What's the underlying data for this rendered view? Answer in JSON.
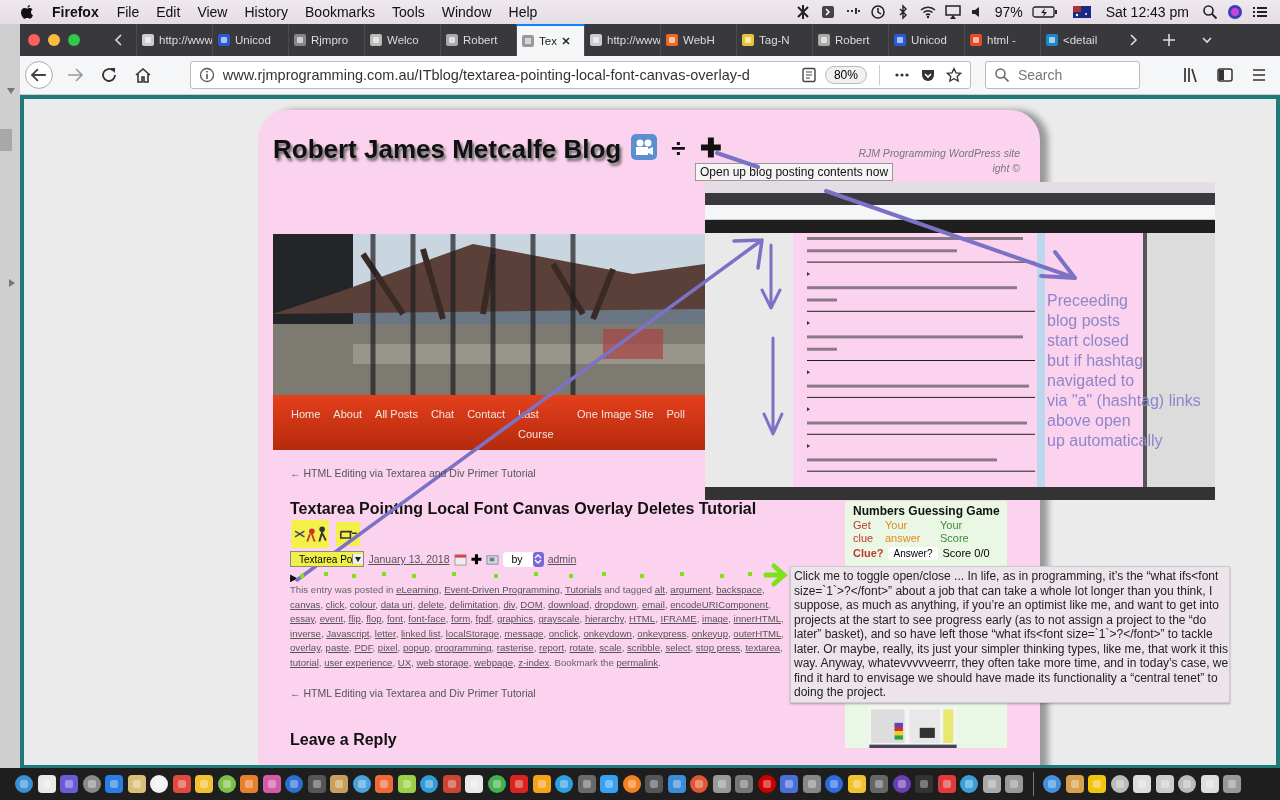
{
  "menubar": {
    "app": "Firefox",
    "menus": [
      "File",
      "Edit",
      "View",
      "History",
      "Bookmarks",
      "Tools",
      "Window",
      "Help"
    ],
    "battery": "97%",
    "clock": "Sat 12:43 pm"
  },
  "tabs": [
    {
      "label": "http://www",
      "selected": false
    },
    {
      "label": "Unicod",
      "selected": false
    },
    {
      "label": "Rjmpro",
      "selected": false
    },
    {
      "label": "Welco",
      "selected": false
    },
    {
      "label": "Robert",
      "selected": false
    },
    {
      "label": "Tex",
      "selected": true
    },
    {
      "label": "http://www",
      "selected": false
    },
    {
      "label": "WebH",
      "selected": false
    },
    {
      "label": "Tag-N",
      "selected": false
    },
    {
      "label": "Robert",
      "selected": false
    },
    {
      "label": "Unicod",
      "selected": false
    },
    {
      "label": "html -",
      "selected": false
    },
    {
      "label": "<detail",
      "selected": false
    }
  ],
  "address_bar": {
    "url": "www.rjmprogramming.com.au/ITblog/textarea-pointing-local-font-canvas-overlay-d",
    "zoom": "80%"
  },
  "search": {
    "placeholder": "Search"
  },
  "blog": {
    "title": "Robert James Metcalfe Blog",
    "title_symbols": [
      "÷",
      "✚"
    ],
    "tooltip": "Open up blog posting contents now",
    "site_note": [
      "RJM Programming WordPress site",
      "ight ©"
    ],
    "nav": [
      {
        "label": "Home"
      },
      {
        "label": "About"
      },
      {
        "label": "All Posts"
      },
      {
        "label": "Chat"
      },
      {
        "label": "Contact"
      },
      {
        "label": "Last Course"
      },
      {
        "label": "One Image Site"
      },
      {
        "label": "Poll"
      }
    ],
    "prev_link": "← HTML Editing via Textarea and Div Primer Tutorial",
    "post": {
      "title": "Textarea Pointing Local Font Canvas Overlay Deletes Tutorial",
      "select_value": "Textarea Po",
      "date": "January 13, 2018",
      "plus": "✚",
      "by": "by",
      "author": "admin",
      "toggle": "▶",
      "meta": {
        "intro": "This entry was posted in ",
        "links": [
          {
            "text": "eLearning",
            "after": ", "
          },
          {
            "text": "Event-Driven Programming",
            "after": ", "
          },
          {
            "text": "Tutorials",
            "after": " and tagged "
          },
          {
            "text": "alt",
            "after": ", "
          },
          {
            "text": "argument",
            "after": ", "
          },
          {
            "text": "backspace",
            "after": ", "
          },
          {
            "text": "canvas",
            "after": ", "
          },
          {
            "text": "click",
            "after": ", "
          },
          {
            "text": "colour",
            "after": ", "
          },
          {
            "text": "data uri",
            "after": ", "
          },
          {
            "text": "delete",
            "after": ", "
          },
          {
            "text": "delimitation",
            "after": ", "
          },
          {
            "text": "div",
            "after": ", "
          },
          {
            "text": "DOM",
            "after": ", "
          },
          {
            "text": "download",
            "after": ", "
          },
          {
            "text": "dropdown",
            "after": ", "
          },
          {
            "text": "email",
            "after": ", "
          },
          {
            "text": "encodeURIComponent",
            "after": ", "
          },
          {
            "text": "essay",
            "after": ", "
          },
          {
            "text": "event",
            "after": ", "
          },
          {
            "text": "flip",
            "after": ", "
          },
          {
            "text": "flop",
            "after": ", "
          },
          {
            "text": "font",
            "after": ", "
          },
          {
            "text": "font-face",
            "after": ", "
          },
          {
            "text": "form",
            "after": ", "
          },
          {
            "text": "fpdf",
            "after": ", "
          },
          {
            "text": "graphics",
            "after": ", "
          },
          {
            "text": "grayscale",
            "after": ", "
          },
          {
            "text": "hierarchy",
            "after": ", "
          },
          {
            "text": "HTML",
            "after": ", "
          },
          {
            "text": "IFRAME",
            "after": ", "
          },
          {
            "text": "image",
            "after": ", "
          },
          {
            "text": "innerHTML",
            "after": ", "
          },
          {
            "text": "inverse",
            "after": ", "
          },
          {
            "text": "Javascript",
            "after": ", "
          },
          {
            "text": "letter",
            "after": ", "
          },
          {
            "text": "linked list",
            "after": ", "
          },
          {
            "text": "localStorage",
            "after": ", "
          },
          {
            "text": "message",
            "after": ", "
          },
          {
            "text": "onclick",
            "after": ", "
          },
          {
            "text": "onkeydown",
            "after": ", "
          },
          {
            "text": "onkeypress",
            "after": ", "
          },
          {
            "text": "onkeyup",
            "after": ", "
          },
          {
            "text": "outerHTML",
            "after": ", "
          },
          {
            "text": "overlay",
            "after": ", "
          },
          {
            "text": "paste",
            "after": ", "
          },
          {
            "text": "PDF",
            "after": ", "
          },
          {
            "text": "pixel",
            "after": ", "
          },
          {
            "text": "popup",
            "after": ", "
          },
          {
            "text": "programming",
            "after": ", "
          },
          {
            "text": "rasterise",
            "after": ", "
          },
          {
            "text": "report",
            "after": ", "
          },
          {
            "text": "rotate",
            "after": ", "
          },
          {
            "text": "scale",
            "after": ", "
          },
          {
            "text": "scribble",
            "after": ", "
          },
          {
            "text": "select",
            "after": ", "
          },
          {
            "text": "stop press",
            "after": ", "
          },
          {
            "text": "textarea",
            "after": ", "
          },
          {
            "text": "tutorial",
            "after": ", "
          },
          {
            "text": "user experience",
            "after": ", "
          },
          {
            "text": "UX",
            "after": ", "
          },
          {
            "text": "web storage",
            "after": ", "
          },
          {
            "text": "webpage",
            "after": ", "
          },
          {
            "text": "z-index",
            "after": ". Bookmark the "
          },
          {
            "text": "permalink",
            "after": "."
          }
        ]
      }
    },
    "prev_link_bottom": "← HTML Editing via Textarea and Div Primer Tutorial",
    "reply_heading": "Leave a Reply"
  },
  "widget": {
    "title": "Numbers Guessing Game",
    "headers": [
      {
        "text": "Get clue",
        "color": "#c0392b"
      },
      {
        "text": "Your answer",
        "color": "#e08a1e"
      },
      {
        "text": "Your Score",
        "color": "#3f8a3a"
      }
    ],
    "clue": "Clue?",
    "answer_value": "Answer?",
    "score": "Score 0/0"
  },
  "popup": {
    "text": "Click me to toggle open/close ... In life, as in programming, it’s the “what ifs<font size=`1`>?</font>” about a job that can take a whole lot longer than you think, I suppose, as much as anything, if you’re an optimist like me, and want to get into projects at the start to see progress early (as to not assign a project to the “do later” basket), and so have left those “what ifs<font size=`1`>?</font>” to tackle later.  Or maybe, really, its just your simpler thinking types, like me, that work it this way.   Anyway, whatevvvvveerrr, they often take more time, and in today’s case, we find it hard to envisage we should have made its functionality a “central tenet” to doing the project."
  },
  "inset": {
    "annotation_lines": [
      "Preceeding",
      "blog posts",
      "start closed",
      "but if hashtag",
      "navigated to",
      "via \"a\" (hashtag) links",
      "above open",
      "up automatically"
    ]
  }
}
